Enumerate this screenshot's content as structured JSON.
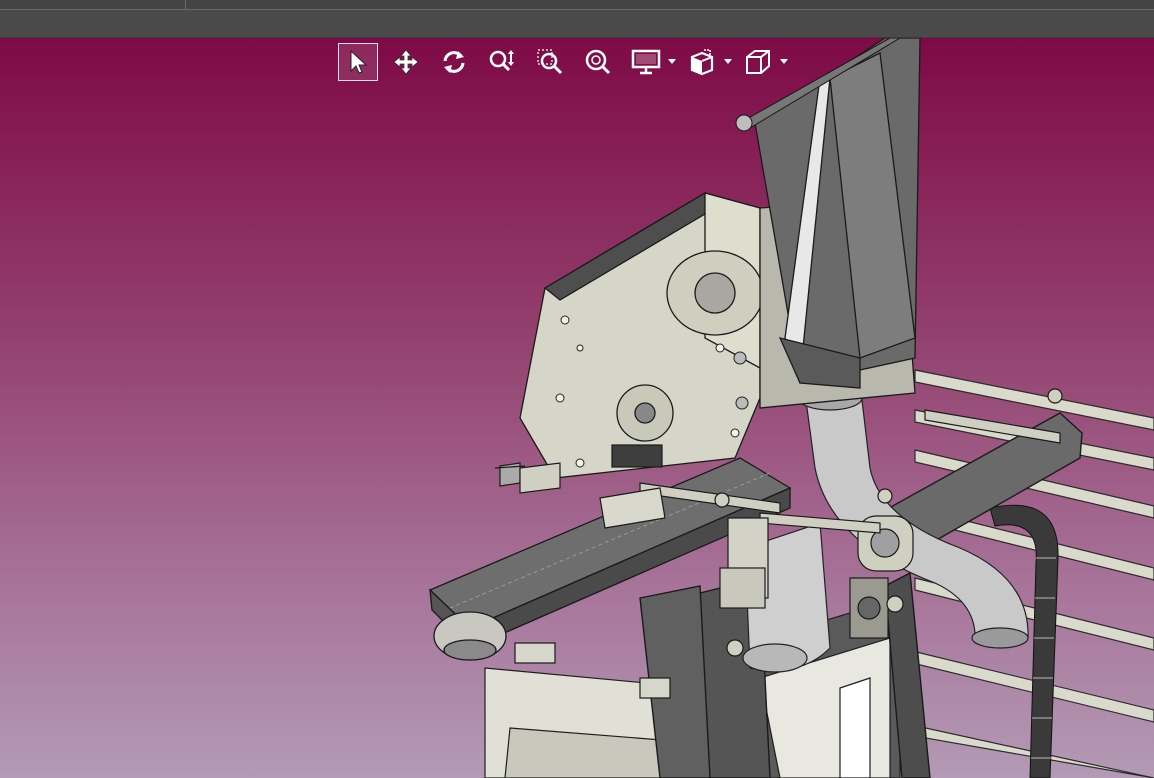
{
  "window": {
    "title": ""
  },
  "toolbar": {
    "tools": [
      {
        "name": "select",
        "icon": "pointer-icon",
        "active": true
      },
      {
        "name": "pan",
        "icon": "move-arrows-icon",
        "active": false
      },
      {
        "name": "rotate",
        "icon": "rotate-icon",
        "active": false
      },
      {
        "name": "zoom",
        "icon": "zoom-updown-icon",
        "active": false
      },
      {
        "name": "zoom-window",
        "icon": "zoom-window-icon",
        "active": false
      },
      {
        "name": "zoom-fit",
        "icon": "zoom-fit-icon",
        "active": false
      },
      {
        "name": "display-mode",
        "icon": "monitor-icon",
        "active": false,
        "dropdown": true
      },
      {
        "name": "section",
        "icon": "section-box-icon",
        "active": false,
        "dropdown": true
      },
      {
        "name": "view-orientation",
        "icon": "cube-icon",
        "active": false,
        "dropdown": true
      }
    ]
  },
  "colors": {
    "viewport_top": "#7e0a45",
    "viewport_bottom": "#b39ab5",
    "toolbar_icon": "#ffffff",
    "chrome": "#4a4a4a",
    "part_light": "#d4d4c4",
    "part_dark": "#5a5a5a"
  }
}
